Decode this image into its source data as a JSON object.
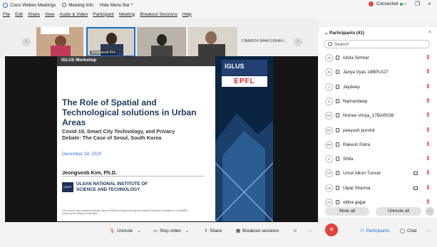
{
  "titlebar": {
    "app": "Cisco Webex Meetings",
    "meeting_info": "Meeting Info",
    "hide_menu": "Hide Menu Bar ^",
    "status": "Connected",
    "min": "–",
    "max": "❐",
    "close": "×"
  },
  "menu": [
    "File",
    "Edit",
    "Share",
    "View",
    "Audio & Video",
    "Participant",
    "Meeting",
    "Breakout Sessions",
    "Help"
  ],
  "thumbnails": {
    "active_name": "Jeongseob Kim",
    "text_tile": "17BAR074 SHAH DISHA K..."
  },
  "slide": {
    "header": "IGLUS Workshop",
    "iglus": "iGLUS",
    "epfl": "EPFL",
    "title": "The Role of Spatial and Technological solutions in Urban Areas",
    "subtitle": "Covid-19, Smart City Technology, and Privacy Debate: The Case of Seoul, South Korea",
    "date": "December 19, 2020",
    "author": "Jeongseob Kim, Ph.D.",
    "institution_line1": "ULSAN NATIONAL INSTITUTE OF",
    "institution_line2": "SCIENCE AND TECHNOLOGY",
    "logo": "UNIST",
    "footnote": "This research was supported by Basic Science Research Program through the National Research Foundation of Korea(NRF) funded by the Ministry of Education"
  },
  "panel": {
    "header": "Participants (41)",
    "search_placeholder": "Search",
    "participants": [
      {
        "initials": "IS",
        "name": "Ishita Simhal",
        "device": "phone",
        "camera": false
      },
      {
        "initials": "JV",
        "name": "Janya Vyas 18BPL027",
        "device": "desktop",
        "camera": false
      },
      {
        "initials": "J",
        "name": "Jaydeep",
        "device": "desktop",
        "camera": false
      },
      {
        "initials": "N",
        "name": "Namandeep",
        "device": "desktop",
        "camera": false
      },
      {
        "initials": "NV",
        "name": "Nishee Viroja_17BAR038",
        "device": "phone",
        "camera": false
      },
      {
        "initials": "PP",
        "name": "peeyush purohit",
        "device": "phone",
        "camera": false
      },
      {
        "initials": "RP",
        "name": "Rakesh Patra",
        "device": "desktop",
        "camera": false
      },
      {
        "initials": "S",
        "name": "Shifa",
        "device": "desktop",
        "camera": false
      },
      {
        "initials": "UT",
        "name": "Umut Alkım Tuncer",
        "device": "phone",
        "camera": true
      },
      {
        "initials": "US",
        "name": "Utpal Sharma",
        "device": "desktop",
        "camera": true
      },
      {
        "initials": "VG",
        "name": "vibha gajjar",
        "device": "phone",
        "camera": false
      }
    ],
    "mute_all": "Mute all",
    "unmute_all": "Unmute all"
  },
  "controls": {
    "unmute": "Unmute",
    "stop_video": "Stop video",
    "share": "Share",
    "breakout": "Breakout sessions",
    "participants": "Participants",
    "chat": "Chat"
  },
  "colors": {
    "accent": "#1a6fc9",
    "danger": "#e0443b",
    "slide_blue": "#1f3b5e"
  }
}
